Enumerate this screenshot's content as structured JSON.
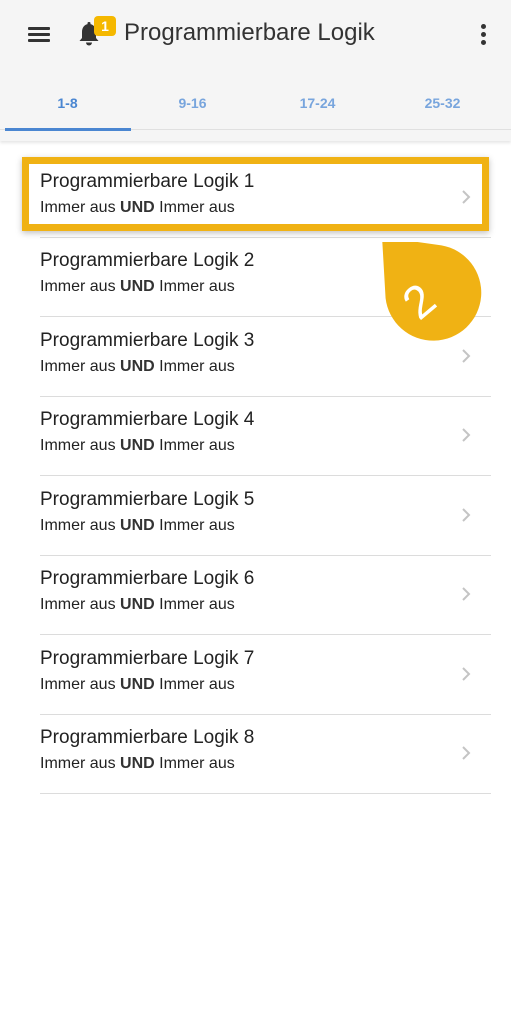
{
  "header": {
    "title": "Programmierbare Logik",
    "notification_count": "1"
  },
  "tabs": [
    {
      "label": "1-8",
      "active": true
    },
    {
      "label": "9-16",
      "active": false
    },
    {
      "label": "17-24",
      "active": false
    },
    {
      "label": "25-32",
      "active": false
    }
  ],
  "items": [
    {
      "name": "Programmierbare Logik 1",
      "cond_a": "Immer aus",
      "op": "UND",
      "cond_b": "Immer aus"
    },
    {
      "name": "Programmierbare Logik 2",
      "cond_a": "Immer aus",
      "op": "UND",
      "cond_b": "Immer aus"
    },
    {
      "name": "Programmierbare Logik 3",
      "cond_a": "Immer aus",
      "op": "UND",
      "cond_b": "Immer aus"
    },
    {
      "name": "Programmierbare Logik 4",
      "cond_a": "Immer aus",
      "op": "UND",
      "cond_b": "Immer aus"
    },
    {
      "name": "Programmierbare Logik 5",
      "cond_a": "Immer aus",
      "op": "UND",
      "cond_b": "Immer aus"
    },
    {
      "name": "Programmierbare Logik 6",
      "cond_a": "Immer aus",
      "op": "UND",
      "cond_b": "Immer aus"
    },
    {
      "name": "Programmierbare Logik 7",
      "cond_a": "Immer aus",
      "op": "UND",
      "cond_b": "Immer aus"
    },
    {
      "name": "Programmierbare Logik 8",
      "cond_a": "Immer aus",
      "op": "UND",
      "cond_b": "Immer aus"
    }
  ],
  "annotation": {
    "step_number": "2",
    "color": "#f0b214"
  },
  "colors": {
    "accent": "#4a86d1",
    "badge": "#f5b800"
  },
  "icons": {
    "menu": "menu-icon",
    "bell": "bell-icon",
    "more": "more-vert-icon",
    "chevron": "chevron-right-icon"
  }
}
